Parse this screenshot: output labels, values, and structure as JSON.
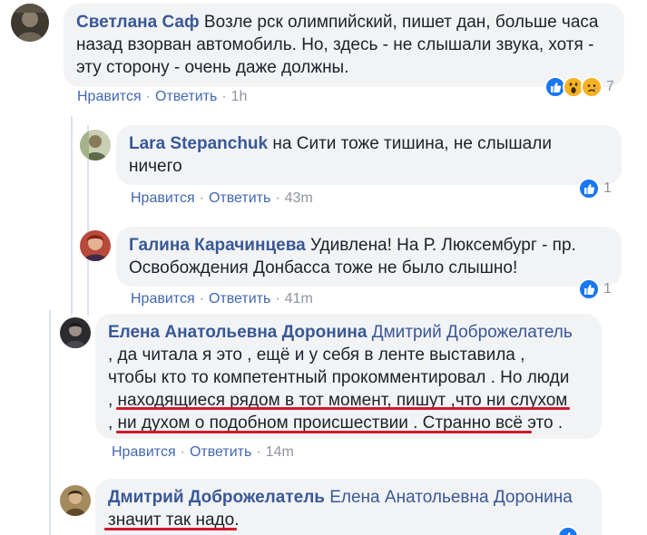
{
  "comments": [
    {
      "author": "Светлана Саф",
      "mention": "",
      "text": "Возле рск олимпийский, пишет дан, больше часа назад взорван автомобиль. Но, здесь - не слышали звука, хотя - эту сторону - очень даже должны.",
      "like_label": "Нравится",
      "reply_label": "Ответить",
      "time": "1h",
      "reaction_count": "7",
      "reactions": [
        "like-icon",
        "wow-icon",
        "sad-icon"
      ]
    },
    {
      "author": "Lara Stepanchuk",
      "mention": "",
      "text": "на Сити тоже тишина, не слышали ничего",
      "like_label": "Нравится",
      "reply_label": "Ответить",
      "time": "43m",
      "reaction_count": "1",
      "reactions": [
        "like-icon"
      ]
    },
    {
      "author": "Галина Карачинцева",
      "mention": "",
      "text": "Удивлена! На Р. Люксембург - пр. Освобождения Донбасса тоже не было слышно!",
      "like_label": "Нравится",
      "reply_label": "Ответить",
      "time": "41m",
      "reaction_count": "1",
      "reactions": [
        "like-icon"
      ]
    },
    {
      "author": "Елена Анатольевна Доронина",
      "mention": "Дмитрий Доброжелатель",
      "text_lines": [
        ", да читала я это , ещё и у себя в ленте выставила ,",
        "чтобы кто то компетентный прокомментировал . Но люди",
        ", находящиеся рядом в тот момент, пишут ,что ни слухом",
        ", ни духом о подобном происшествии . Странно всё это ."
      ],
      "like_label": "Нравится",
      "reply_label": "Ответить",
      "time": "14m"
    },
    {
      "author": "Дмитрий Доброжелатель",
      "mention": "Елена Анатольевна Доронина",
      "text": "значит так надо."
    }
  ],
  "separator": "·",
  "colors": {
    "link": "#385898",
    "action": "#4267b2",
    "meta": "#90949c",
    "bubble": "#f2f3f5",
    "underline": "#d11a2a",
    "like": "#1877f2",
    "emoji": "#f7b125"
  }
}
